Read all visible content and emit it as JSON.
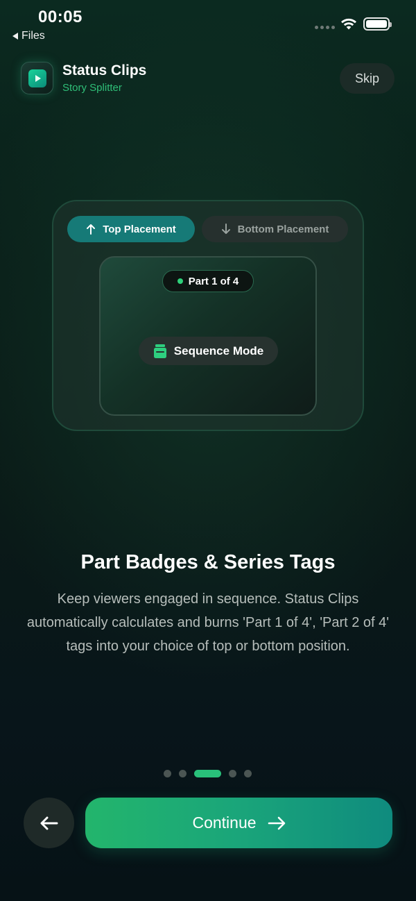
{
  "status_bar": {
    "time": "00:05",
    "back_label": "Files"
  },
  "header": {
    "app_name": "Status Clips",
    "app_subtitle": "Story Splitter",
    "skip_label": "Skip"
  },
  "preview": {
    "placement_options": [
      {
        "label": "Top Placement",
        "selected": true
      },
      {
        "label": "Bottom Placement",
        "selected": false
      }
    ],
    "part_badge": "Part 1 of 4",
    "mode_label": "Sequence Mode"
  },
  "content": {
    "title": "Part Badges & Series Tags",
    "description": "Keep viewers engaged in sequence. Status Clips automatically calculates and burns 'Part 1 of 4', 'Part 2 of 4' tags into your choice of top or bottom position."
  },
  "pagination": {
    "total": 5,
    "current": 3
  },
  "footer": {
    "continue_label": "Continue"
  },
  "colors": {
    "accent_green": "#2fbf78",
    "accent_teal": "#167a77",
    "background": "#0a1a17"
  }
}
